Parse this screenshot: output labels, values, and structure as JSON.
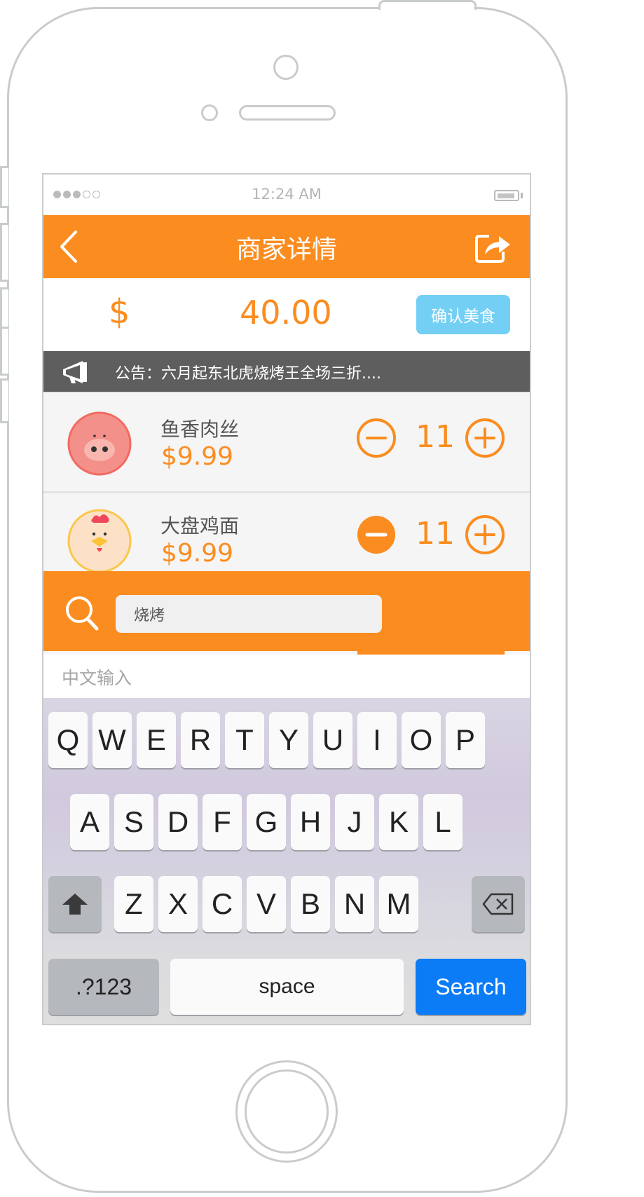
{
  "status_bar": {
    "time": "12:24 AM",
    "signal_dots": [
      "on",
      "on",
      "on",
      "off",
      "off"
    ]
  },
  "nav": {
    "title": "商家详情",
    "back_icon": "chevron-left-icon",
    "share_icon": "share-icon"
  },
  "price_bar": {
    "currency": "$",
    "amount": "40.00",
    "confirm_label": "确认美食"
  },
  "notice": {
    "icon": "megaphone-icon",
    "text": "公告：六月起东北虎烧烤王全场三折...."
  },
  "items": [
    {
      "name": "鱼香肉丝",
      "price": "$9.99",
      "quantity": "11",
      "avatar": "pig-icon",
      "minus_style": "outline"
    },
    {
      "name": "大盘鸡面",
      "price": "$9.99",
      "quantity": "11",
      "avatar": "chicken-icon",
      "minus_style": "filled"
    }
  ],
  "search": {
    "query": "烧烤"
  },
  "ime": {
    "candidate_label": "中文输入"
  },
  "keyboard": {
    "row1": [
      "Q",
      "W",
      "E",
      "R",
      "T",
      "Y",
      "U",
      "I",
      "O",
      "P"
    ],
    "row2": [
      "A",
      "S",
      "D",
      "F",
      "G",
      "H",
      "J",
      "K",
      "L"
    ],
    "row3": [
      "Z",
      "X",
      "C",
      "V",
      "B",
      "N",
      "M"
    ],
    "numbers_label": ".?123",
    "space_label": "space",
    "search_label": "Search"
  },
  "colors": {
    "accent": "#fb8c1f",
    "confirm_button": "#73cff4",
    "notice_bg": "#5e5e5e",
    "search_key": "#0b7bf6"
  }
}
